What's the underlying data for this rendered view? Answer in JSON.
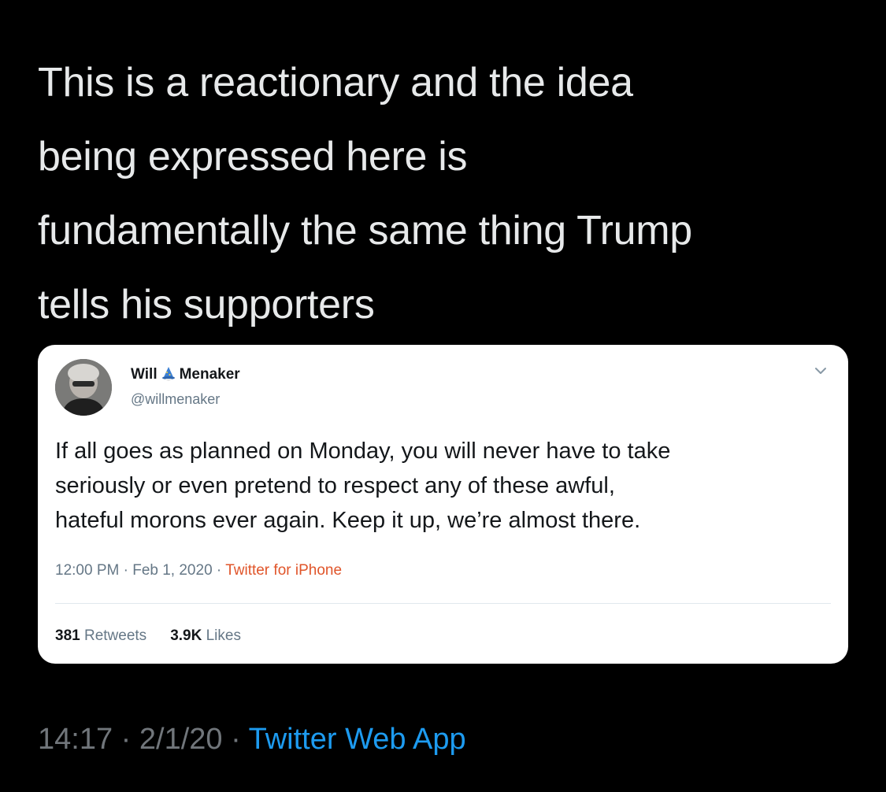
{
  "tweet": {
    "lines": [
      "This is a reactionary and the idea",
      "being expressed here is",
      "fundamentally the same thing Trump",
      "tells his supporters"
    ],
    "time": "14:17",
    "separator": "·",
    "date": "2/1/20",
    "source": "Twitter Web App"
  },
  "embed": {
    "name_first": "Will",
    "name_last": "Menaker",
    "handle": "@willmenaker",
    "lines": [
      "If all goes as planned on Monday, you will never have to take",
      "seriously or even pretend to respect any of these awful,",
      "hateful morons ever again. Keep it up, we’re almost there."
    ],
    "time": "12:00 PM",
    "date": "Feb 1, 2020",
    "source": "Twitter for iPhone",
    "separator": "·",
    "retweets_count": "381",
    "retweets_label": "Retweets",
    "likes_count": "3.9K",
    "likes_label": "Likes"
  },
  "icons": {
    "avatar": "avatar-photo",
    "name_emoji": "wizard-icon",
    "menu": "chevron-down-icon"
  },
  "colors": {
    "background": "#000000",
    "text": "#e7e9ea",
    "secondary": "#71767b",
    "link": "#1d9bf0",
    "embed_source": "#e0552a"
  }
}
